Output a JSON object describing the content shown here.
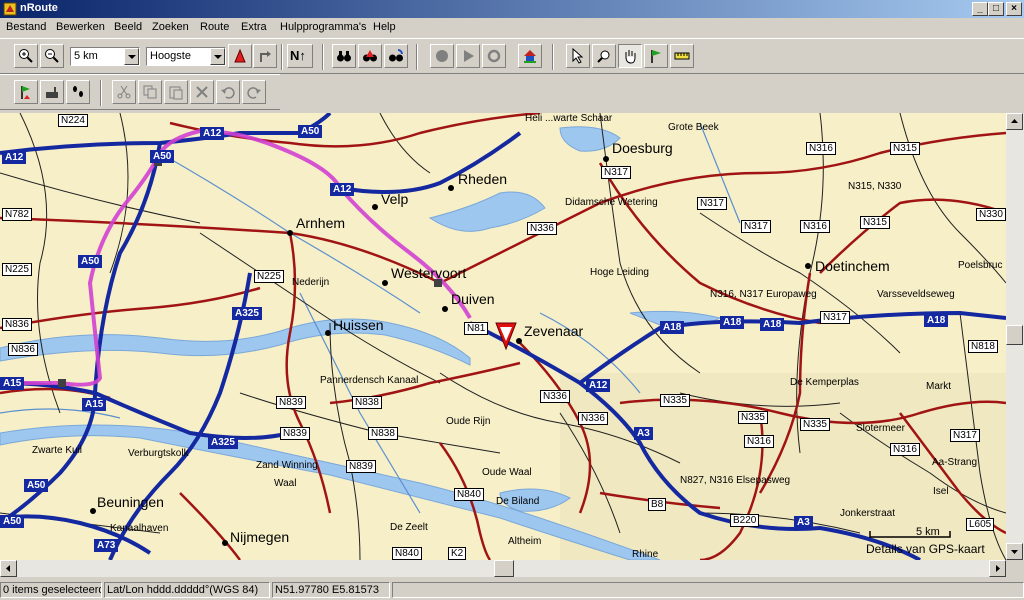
{
  "window": {
    "title": "nRoute",
    "minimize": "_",
    "maximize": "□",
    "close": "×"
  },
  "menu": {
    "items": [
      "Bestand",
      "Bewerken",
      "Beeld",
      "Zoeken",
      "Route",
      "Extra",
      "Hulpprogramma's",
      "Help"
    ]
  },
  "toolbar": {
    "zoom_value": "5 km",
    "detail_value": "Hoogste",
    "north_label": "N↑"
  },
  "map": {
    "road_labels": [
      {
        "text": "N224",
        "type": "n"
      },
      {
        "text": "A12",
        "type": "a"
      },
      {
        "text": "A50",
        "type": "a"
      },
      {
        "text": "A12",
        "type": "a"
      },
      {
        "text": "A50",
        "type": "a"
      },
      {
        "text": "A12",
        "type": "a"
      },
      {
        "text": "N782",
        "type": "n"
      },
      {
        "text": "A50",
        "type": "a"
      },
      {
        "text": "N225",
        "type": "n"
      },
      {
        "text": "N225",
        "type": "n"
      },
      {
        "text": "A325",
        "type": "a"
      },
      {
        "text": "N836",
        "type": "n"
      },
      {
        "text": "N836",
        "type": "n"
      },
      {
        "text": "A15",
        "type": "a"
      },
      {
        "text": "A15",
        "type": "a"
      },
      {
        "text": "N839",
        "type": "n"
      },
      {
        "text": "N839",
        "type": "n"
      },
      {
        "text": "N838",
        "type": "n"
      },
      {
        "text": "N838",
        "type": "n"
      },
      {
        "text": "A325",
        "type": "a"
      },
      {
        "text": "N839",
        "type": "n"
      },
      {
        "text": "A50",
        "type": "a"
      },
      {
        "text": "A50",
        "type": "a"
      },
      {
        "text": "A73",
        "type": "a"
      },
      {
        "text": "N840",
        "type": "n"
      },
      {
        "text": "N840",
        "type": "n"
      },
      {
        "text": "K2",
        "type": "n"
      },
      {
        "text": "N81",
        "type": "n"
      },
      {
        "text": "N336",
        "type": "n"
      },
      {
        "text": "N317",
        "type": "n"
      },
      {
        "text": "N317",
        "type": "n"
      },
      {
        "text": "N317",
        "type": "n"
      },
      {
        "text": "N316",
        "type": "n"
      },
      {
        "text": "N315",
        "type": "n"
      },
      {
        "text": "N316",
        "type": "n"
      },
      {
        "text": "N315",
        "type": "n"
      },
      {
        "text": "N330",
        "type": "n"
      },
      {
        "text": "A18",
        "type": "a"
      },
      {
        "text": "A18",
        "type": "a"
      },
      {
        "text": "A18",
        "type": "a"
      },
      {
        "text": "N317",
        "type": "n"
      },
      {
        "text": "A18",
        "type": "a"
      },
      {
        "text": "N818",
        "type": "n"
      },
      {
        "text": "A12",
        "type": "a"
      },
      {
        "text": "N336",
        "type": "n"
      },
      {
        "text": "N335",
        "type": "n"
      },
      {
        "text": "N336",
        "type": "n"
      },
      {
        "text": "A3",
        "type": "a"
      },
      {
        "text": "N335",
        "type": "n"
      },
      {
        "text": "N335",
        "type": "n"
      },
      {
        "text": "N316",
        "type": "n"
      },
      {
        "text": "N316",
        "type": "n"
      },
      {
        "text": "N317",
        "type": "n"
      },
      {
        "text": "B8",
        "type": "n"
      },
      {
        "text": "B220",
        "type": "n"
      },
      {
        "text": "A3",
        "type": "a"
      },
      {
        "text": "L605",
        "type": "n"
      }
    ],
    "cities": [
      "Doesburg",
      "Rheden",
      "Velp",
      "Arnhem",
      "Westervoort",
      "Duiven",
      "Zevenaar",
      "Huissen",
      "Doetinchem",
      "Beuningen",
      "Nijmegen"
    ],
    "places": [
      "Heli ...warte Schaar",
      "Grote Beek",
      "Didamsche Wetering",
      "N315, N330",
      "Hoge Leiding",
      "Poelsbruc",
      "N316, N317 Europaweg",
      "Varsseveldseweg",
      "Nederijn",
      "De Kemperplas",
      "Markt",
      "Pannerdensch Kanaal",
      "Oude Rijn",
      "Slotermeer",
      "Aa-Strang",
      "Oude Waal",
      "N827, N316 Elsepasweg",
      "Zwarte Kuil",
      "Verburgtskolk",
      "Zand Winning",
      "Waal",
      "De Biland",
      "Isel",
      "Kanaalhaven",
      "De Zeelt",
      "Altheim",
      "Rhine",
      "Jonkerstraat"
    ],
    "scale_text": "5 km",
    "source_text": "Details van GPS-kaart"
  },
  "status": {
    "selection": "0 items geselecteerd",
    "format": "Lat/Lon hddd.ddddd°(WGS 84)",
    "coords": "N51.97780 E5.81573"
  },
  "colors": {
    "motorway": "#1428a0",
    "main_road": "#a01414",
    "route": "#d040d0",
    "water": "#9ec7f0",
    "land": "#f7efc8"
  }
}
